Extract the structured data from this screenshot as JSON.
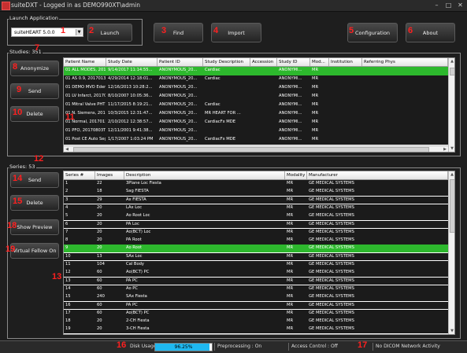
{
  "window": {
    "title": "suiteDXT - Logged in as DEMO990XT\\admin",
    "minimize": "–",
    "maximize": "□",
    "close": "✕"
  },
  "launch": {
    "label": "Launch Application",
    "selected": "suiteHEART 5.0.0",
    "button": "Launch"
  },
  "toolbar": {
    "find": "Find",
    "import": "Import",
    "configuration": "Configuration",
    "about": "About"
  },
  "callouts": [
    "1",
    "2",
    "3",
    "4",
    "5",
    "6",
    "7",
    "8",
    "9",
    "10",
    "11",
    "12",
    "13",
    "14",
    "15",
    "16",
    "17",
    "18",
    "19"
  ],
  "studies": {
    "label": "Studies: 351",
    "buttons": {
      "anonymize": "Anonymize",
      "send": "Send",
      "delete": "Delete"
    },
    "columns": [
      "Patient Name",
      "Study Date",
      "Patient ID",
      "Study Description",
      "Accession",
      "Study ID",
      "Mod...",
      "Institution",
      "Referring Phys"
    ],
    "rows": [
      [
        "01 ALL MODES, 20171113T...",
        "9/14/2017 11:14:55...",
        "ANONYMOUS_20...",
        "Cardiac",
        "",
        "ANONYMI...",
        "MR",
        "",
        ""
      ],
      [
        "01 AS 0.9, 20170131T090646",
        "4/29/2014 12:18:01...",
        "ANONYMOUS_20...",
        "Cardiac",
        "",
        "ANONYMI...",
        "MR",
        "",
        ""
      ],
      [
        "01 DEMO MVO Edema, 2015...",
        "12/16/2013 10:28:2...",
        "ANONYMOUS_20...",
        "",
        "",
        "ANONYMI...",
        "MR",
        "",
        ""
      ],
      [
        "01 LV Infarct, 20170113T09...",
        "8/10/2007 10:05:36...",
        "ANONYMOUS_20...",
        "",
        "",
        "ANONYMI...",
        "MR",
        "",
        ""
      ],
      [
        "01 Mitral Valve PHT, 201701...",
        "11/17/2015 8:19:21...",
        "ANONYMOUS_20...",
        "Cardiac",
        "",
        "ANONYMI...",
        "MR",
        "",
        ""
      ],
      [
        "01 N. Siemens, 20170113T09...",
        "10/3/2015 12:31:47...",
        "ANONYMOUS_20...",
        "MR HEART FOR ...",
        "",
        "ANONYMI...",
        "MR",
        "",
        ""
      ],
      [
        "01 Normal, 20170113T093102",
        "2/10/2012 12:38:57...",
        "ANONYMOUS_20...",
        "CardiacFx MDE",
        "",
        "ANONYMI...",
        "MR",
        "",
        ""
      ],
      [
        "01 PFO, 20170803T113337",
        "12/11/2001 9:41:38...",
        "ANONYMOUS_20...",
        "",
        "",
        "ANONYMI...",
        "MR",
        "",
        ""
      ],
      [
        "01 Post CE Auto Seg#2, 2011...",
        "1/17/2007 1:03:24 PM",
        "ANONYMOUS_20...",
        "CardiacFx MDE",
        "",
        "ANONYMI...",
        "MR",
        "",
        ""
      ]
    ]
  },
  "series": {
    "label": "Series: 53",
    "buttons": {
      "send": "Send",
      "delete": "Delete",
      "show_preview": "Show Preview",
      "virtual_fellow": "Virtual Fellow On"
    },
    "columns": [
      "Series #",
      "Images",
      "Description",
      "Modality",
      "Manufacturer"
    ],
    "rows": [
      [
        "1",
        "22",
        "3Plane Loc Fiesta",
        "MR",
        "GE MEDICAL SYSTEMS"
      ],
      [
        "2",
        "18",
        "Sag FIESTA",
        "MR",
        "GE MEDICAL SYSTEMS"
      ],
      [
        "3",
        "29",
        "Ax FIESTA",
        "MR",
        "GE MEDICAL SYSTEMS"
      ],
      [
        "4",
        "20",
        "LAx Loc",
        "MR",
        "GE MEDICAL SYSTEMS"
      ],
      [
        "5",
        "20",
        "Ao Root Loc",
        "MR",
        "GE MEDICAL SYSTEMS"
      ],
      [
        "6",
        "20",
        "PA Loc",
        "MR",
        "GE MEDICAL SYSTEMS"
      ],
      [
        "7",
        "20",
        "Ao(BCT) Loc",
        "MR",
        "GE MEDICAL SYSTEMS"
      ],
      [
        "8",
        "20",
        "PA Root",
        "MR",
        "GE MEDICAL SYSTEMS"
      ],
      [
        "9",
        "20",
        "Ao Root",
        "MR",
        "GE MEDICAL SYSTEMS"
      ],
      [
        "10",
        "13",
        "SAx Loc",
        "MR",
        "GE MEDICAL SYSTEMS"
      ],
      [
        "11",
        "104",
        "Cal Body",
        "MR",
        "GE MEDICAL SYSTEMS"
      ],
      [
        "12",
        "60",
        "Ao(BCT) PC",
        "MR",
        "GE MEDICAL SYSTEMS"
      ],
      [
        "13",
        "60",
        "PA PC",
        "MR",
        "GE MEDICAL SYSTEMS"
      ],
      [
        "14",
        "60",
        "Ao PC",
        "MR",
        "GE MEDICAL SYSTEMS"
      ],
      [
        "15",
        "240",
        "SAx Fiesta",
        "MR",
        "GE MEDICAL SYSTEMS"
      ],
      [
        "16",
        "60",
        "PA PC",
        "MR",
        "GE MEDICAL SYSTEMS"
      ],
      [
        "17",
        "60",
        "Ao(BCT) PC",
        "MR",
        "GE MEDICAL SYSTEMS"
      ],
      [
        "18",
        "20",
        "2-CH Fiesta",
        "MR",
        "GE MEDICAL SYSTEMS"
      ],
      [
        "19",
        "20",
        "3-CH Fiesta",
        "MR",
        "GE MEDICAL SYSTEMS"
      ]
    ]
  },
  "statusbar": {
    "disk_label": "Disk Usage",
    "disk_value": "96.25%",
    "disk_fraction": 0.9625,
    "preprocessing": "Preprocessing : On",
    "access_control": "Access Control : Off",
    "network": "No DICOM Network Activity"
  },
  "colors": {
    "selected_row": "#2db82d",
    "callout": "#ff2020",
    "progress": "#1fb8f0"
  }
}
